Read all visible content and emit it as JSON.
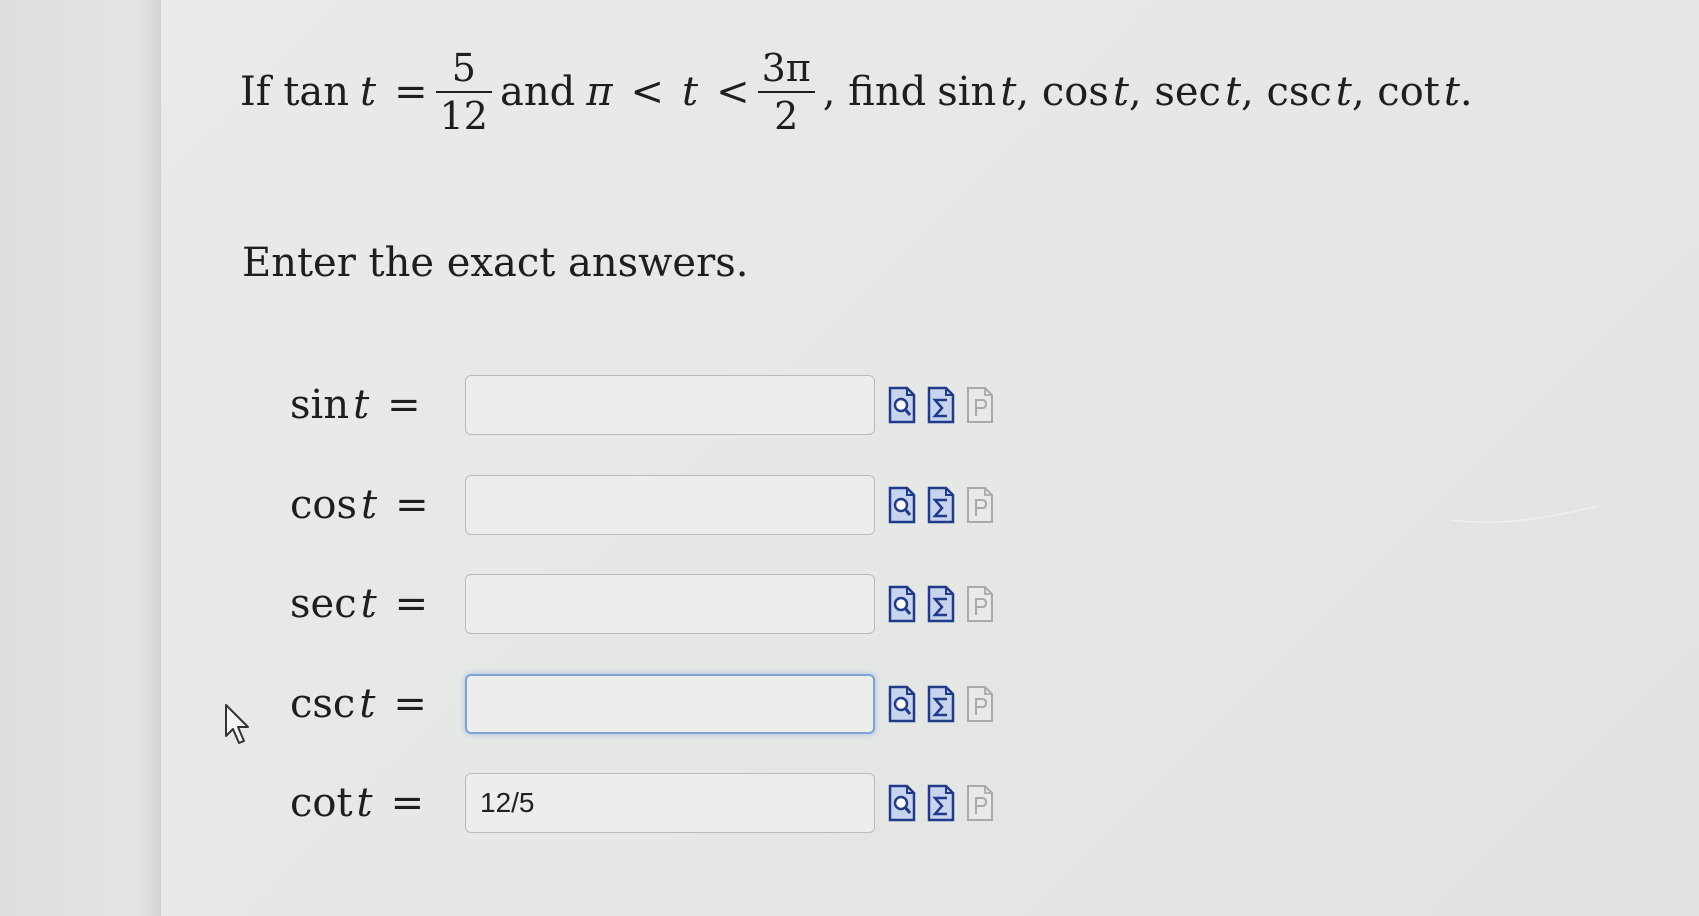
{
  "question": {
    "prefix": "If tan",
    "var_t": "t",
    "equals": "=",
    "frac1_num": "5",
    "frac1_den": "12",
    "and_word": "and",
    "pi": "π",
    "lt1": "<",
    "var_t2": "t",
    "lt2": "<",
    "frac2_num": "3π",
    "frac2_den": "2",
    "find_text": ", find",
    "find_list": [
      {
        "fn": "sin",
        "var": "t",
        "sep": ","
      },
      {
        "fn": "cos",
        "var": "t",
        "sep": ","
      },
      {
        "fn": "sec",
        "var": "t",
        "sep": ","
      },
      {
        "fn": "csc",
        "var": "t",
        "sep": ","
      },
      {
        "fn": "cot",
        "var": "t",
        "sep": "."
      }
    ]
  },
  "instruction": "Enter the exact answers.",
  "answers": [
    {
      "fn": "sin",
      "var": "t",
      "eq": "=",
      "value": "",
      "focused": false
    },
    {
      "fn": "cos",
      "var": "t",
      "eq": "=",
      "value": "",
      "focused": false
    },
    {
      "fn": "sec",
      "var": "t",
      "eq": "=",
      "value": "",
      "focused": false
    },
    {
      "fn": "csc",
      "var": "t",
      "eq": "=",
      "value": "",
      "focused": true
    },
    {
      "fn": "cot",
      "var": "t",
      "eq": "=",
      "value": "12/5",
      "focused": false
    }
  ],
  "tool_icons": [
    "preview-icon",
    "equation-editor-icon",
    "hint-icon"
  ],
  "colors": {
    "icon_blue": "#1f3c8c",
    "icon_fill": "#c8d3ee",
    "focus_border": "#7ea4d6",
    "hint_gray": "#a8aaa8"
  }
}
